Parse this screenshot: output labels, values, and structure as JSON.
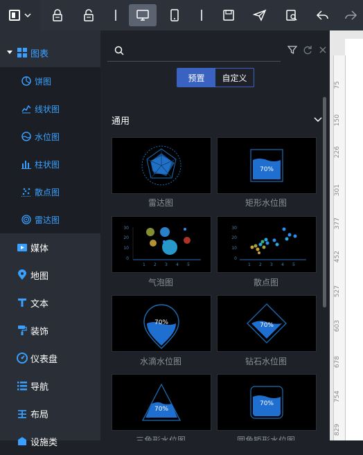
{
  "sidebar": {
    "categories": [
      {
        "label": "图表",
        "icon": "chart-grid-icon",
        "expanded": true
      },
      {
        "label": "媒体",
        "icon": "media-icon"
      },
      {
        "label": "地图",
        "icon": "map-pin-icon"
      },
      {
        "label": "文本",
        "icon": "text-icon"
      },
      {
        "label": "装饰",
        "icon": "paint-roller-icon"
      },
      {
        "label": "仪表盘",
        "icon": "gauge-icon"
      },
      {
        "label": "导航",
        "icon": "list-icon"
      },
      {
        "label": "布局",
        "icon": "layout-icon"
      },
      {
        "label": "设施类",
        "icon": "facility-icon"
      }
    ],
    "chart_items": [
      {
        "label": "饼图",
        "icon": "pie-chart-icon"
      },
      {
        "label": "线状图",
        "icon": "line-chart-icon"
      },
      {
        "label": "水位图",
        "icon": "water-level-icon"
      },
      {
        "label": "柱状图",
        "icon": "bar-chart-icon"
      },
      {
        "label": "散点图",
        "icon": "scatter-icon"
      },
      {
        "label": "雷达图",
        "icon": "radar-icon"
      }
    ]
  },
  "panel": {
    "tabs": [
      "预置",
      "自定义"
    ],
    "active_tab": "预置",
    "section_title": "通用",
    "items": [
      {
        "label": "雷达图"
      },
      {
        "label": "矩形水位图",
        "value": "70%"
      },
      {
        "label": "气泡图"
      },
      {
        "label": "散点图"
      },
      {
        "label": "水滴水位图",
        "value": "70%"
      },
      {
        "label": "钻石水位图",
        "value": "70%"
      },
      {
        "label": "三角形水位图",
        "value": "70%"
      },
      {
        "label": "圆角矩形水位图",
        "value": "70%"
      }
    ]
  },
  "ruler": {
    "ticks": [
      "75",
      "150",
      "226",
      "301",
      "377",
      "452",
      "527",
      "603",
      "678",
      "754",
      "829"
    ]
  },
  "colors": {
    "accent": "#3a62c0",
    "link": "#3aa0ff",
    "bg": "#1e2228",
    "sidebar": "#2a2e36"
  }
}
